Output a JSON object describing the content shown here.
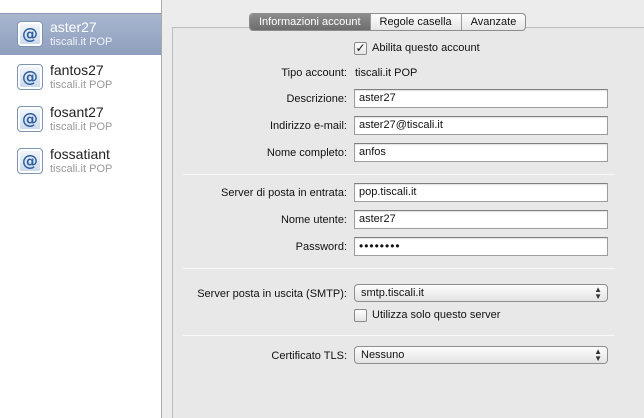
{
  "sidebar": {
    "accounts": [
      {
        "name": "aster27",
        "type": "tiscali.it POP",
        "icon": "at-icon"
      },
      {
        "name": "fantos27",
        "type": "tiscali.it POP",
        "icon": "at-icon"
      },
      {
        "name": "fosant27",
        "type": "tiscali.it POP",
        "icon": "at-icon"
      },
      {
        "name": "fossatiant",
        "type": "tiscali.it POP",
        "icon": "at-icon"
      }
    ],
    "selected_index": 0,
    "selection_color": "#98a8c4"
  },
  "tabs": [
    {
      "label": "Informazioni account",
      "active": true
    },
    {
      "label": "Regole casella",
      "active": false
    },
    {
      "label": "Avanzate",
      "active": false
    }
  ],
  "form": {
    "enable": {
      "label": "Abilita questo account",
      "checked": true
    },
    "account_type": {
      "label": "Tipo account:",
      "value": "tiscali.it POP"
    },
    "description": {
      "label": "Descrizione:",
      "value": "aster27"
    },
    "email": {
      "label": "Indirizzo e-mail:",
      "value": "aster27@tiscali.it"
    },
    "full_name": {
      "label": "Nome completo:",
      "value": "anfos"
    },
    "incoming_server": {
      "label": "Server di posta in entrata:",
      "value": "pop.tiscali.it"
    },
    "username": {
      "label": "Nome utente:",
      "value": "aster27"
    },
    "password": {
      "label": "Password:",
      "value": "••••••••"
    },
    "smtp": {
      "label": "Server posta in uscita (SMTP):",
      "selected": "smtp.tiscali.it"
    },
    "only_this_server": {
      "label": "Utilizza solo questo server",
      "checked": false
    },
    "tls": {
      "label": "Certificato TLS:",
      "selected": "Nessuno"
    }
  }
}
